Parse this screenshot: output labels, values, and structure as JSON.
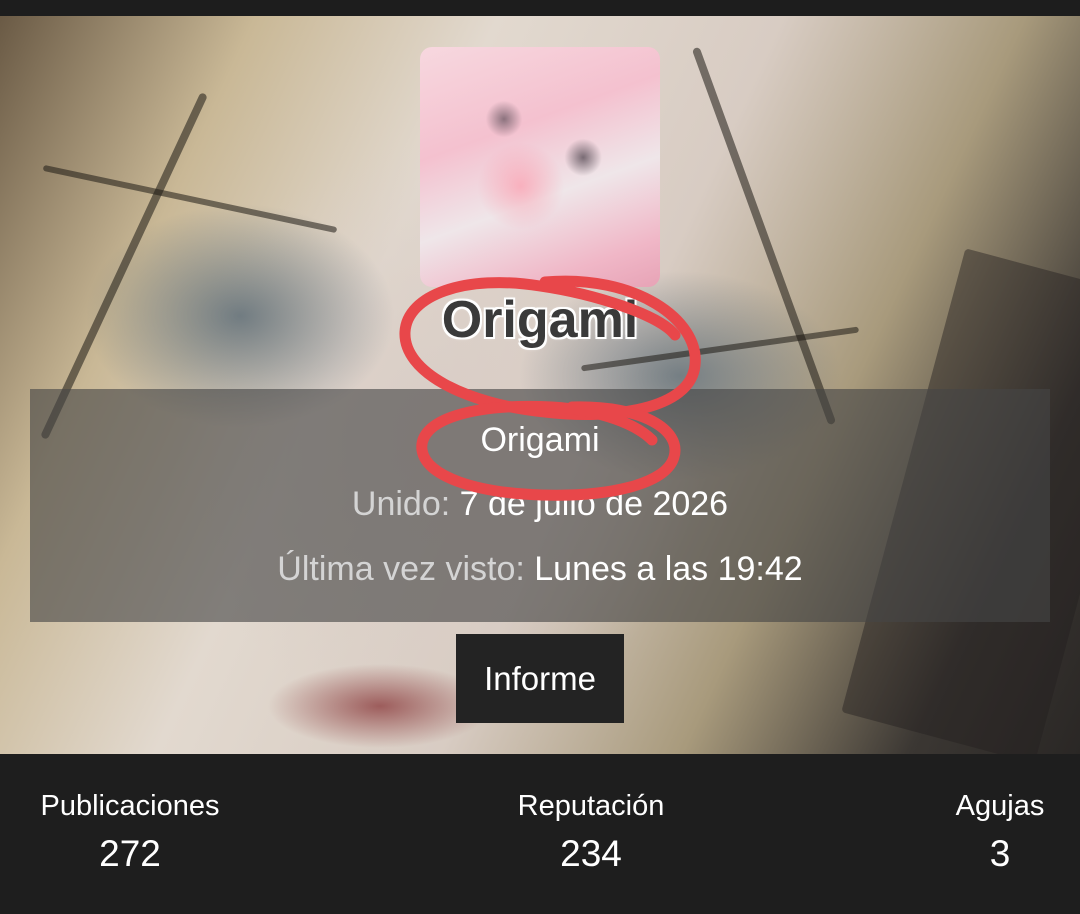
{
  "profile": {
    "display_name": "Origami",
    "username": "Origami",
    "joined_label": "Unido:",
    "joined_value": "7 de julio de 2026",
    "last_seen_label": "Última vez visto:",
    "last_seen_value": "Lunes a las 19:42",
    "report_label": "Informe"
  },
  "stats": [
    {
      "label": "Publicaciones",
      "value": "272"
    },
    {
      "label": "Reputación",
      "value": "234"
    },
    {
      "label": "Agujas",
      "value": "3"
    }
  ],
  "colors": {
    "page_background": "#1e1e1e",
    "annotation_red": "#e8474a",
    "button_background": "#232323"
  }
}
